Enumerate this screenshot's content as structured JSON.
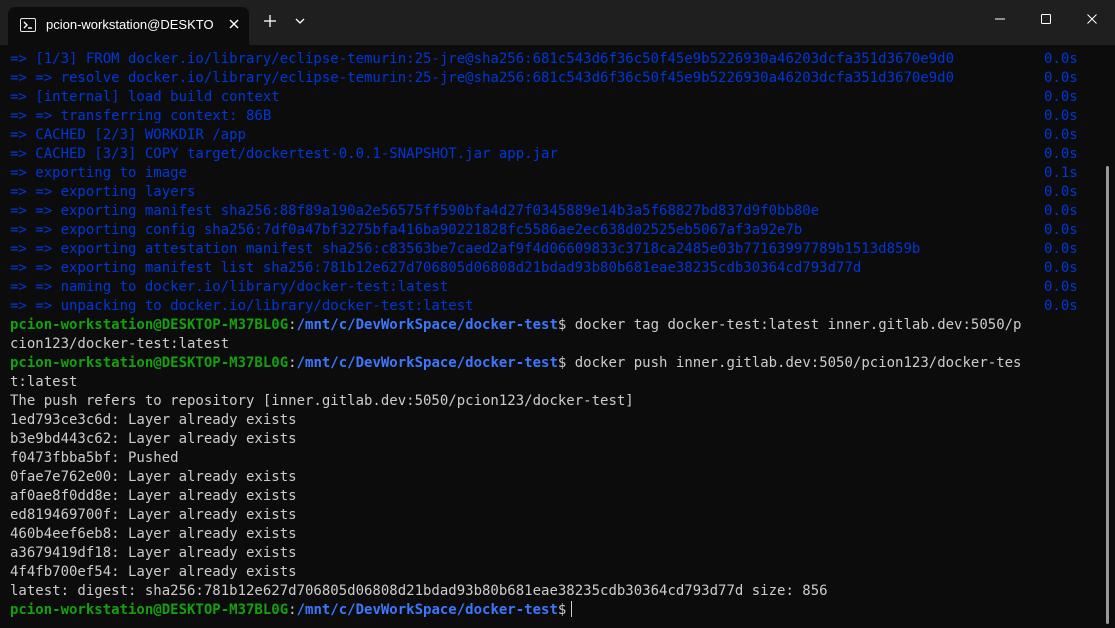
{
  "window": {
    "tab_title": "pcion-workstation@DESKTOP-",
    "icons": {
      "tab_icon": "terminal-icon",
      "tab_close": "close-icon",
      "new_tab": "plus-icon",
      "dropdown": "chevron-down-icon",
      "minimize": "minimize-icon",
      "maximize": "maximize-icon",
      "close": "close-icon"
    }
  },
  "colors": {
    "background": "#0c0c0c",
    "titlebar": "#1f1f1f",
    "buildkit_blue": "#0037da",
    "prompt_green": "#13a10e",
    "prompt_path_blue": "#3b78ff",
    "text": "#cccccc"
  },
  "build_lines": [
    {
      "text": "=> [1/3] FROM docker.io/library/eclipse-temurin:25-jre@sha256:681c543d6f36c50f45e9b5226930a46203dcfa351d3670e9d0",
      "duration": "0.0s"
    },
    {
      "text": "=> => resolve docker.io/library/eclipse-temurin:25-jre@sha256:681c543d6f36c50f45e9b5226930a46203dcfa351d3670e9d0",
      "duration": "0.0s"
    },
    {
      "text": "=> [internal] load build context",
      "duration": "0.0s"
    },
    {
      "text": "=> => transferring context: 86B",
      "duration": "0.0s"
    },
    {
      "text": "=> CACHED [2/3] WORKDIR /app",
      "duration": "0.0s"
    },
    {
      "text": "=> CACHED [3/3] COPY target/dockertest-0.0.1-SNAPSHOT.jar app.jar",
      "duration": "0.0s"
    },
    {
      "text": "=> exporting to image",
      "duration": "0.1s"
    },
    {
      "text": "=> => exporting layers",
      "duration": "0.0s"
    },
    {
      "text": "=> => exporting manifest sha256:88f89a190a2e56575ff590bfa4d27f0345889e14b3a5f68827bd837d9f0bb80e",
      "duration": "0.0s"
    },
    {
      "text": "=> => exporting config sha256:7df0a47bf3275bfa416ba90221828fc5586ae2ec638d02525eb5067af3a92e7b",
      "duration": "0.0s"
    },
    {
      "text": "=> => exporting attestation manifest sha256:c83563be7caed2af9f4d06609833c3718ca2485e03b77163997789b1513d859b",
      "duration": "0.0s"
    },
    {
      "text": "=> => exporting manifest list sha256:781b12e627d706805d06808d21bdad93b80b681eae38235cdb30364cd793d77d",
      "duration": "0.0s"
    },
    {
      "text": "=> => naming to docker.io/library/docker-test:latest",
      "duration": "0.0s"
    },
    {
      "text": "=> => unpacking to docker.io/library/docker-test:latest",
      "duration": "0.0s"
    }
  ],
  "prompt": {
    "user_host": "pcion-workstation@DESKTOP-M37BL0G",
    "sep": ":",
    "cwd": "/mnt/c/DevWorkSpace/docker-test",
    "symbol": "$"
  },
  "commands": {
    "tag_cmd_line1": " docker tag docker-test:latest inner.gitlab.dev:5050/p",
    "tag_cmd_line2": "cion123/docker-test:latest",
    "push_cmd_line1": " docker push inner.gitlab.dev:5050/pcion123/docker-tes",
    "push_cmd_line2": "t:latest"
  },
  "push_output": [
    "The push refers to repository [inner.gitlab.dev:5050/pcion123/docker-test]",
    "1ed793ce3c6d: Layer already exists",
    "b3e9bd443c62: Layer already exists",
    "f0473fbba5bf: Pushed",
    "0fae7e762e00: Layer already exists",
    "af0ae8f0dd8e: Layer already exists",
    "ed819469700f: Layer already exists",
    "460b4eef6eb8: Layer already exists",
    "a3679419df18: Layer already exists",
    "4f4fb700ef54: Layer already exists",
    "latest: digest: sha256:781b12e627d706805d06808d21bdad93b80b681eae38235cdb30364cd793d77d size: 856"
  ]
}
